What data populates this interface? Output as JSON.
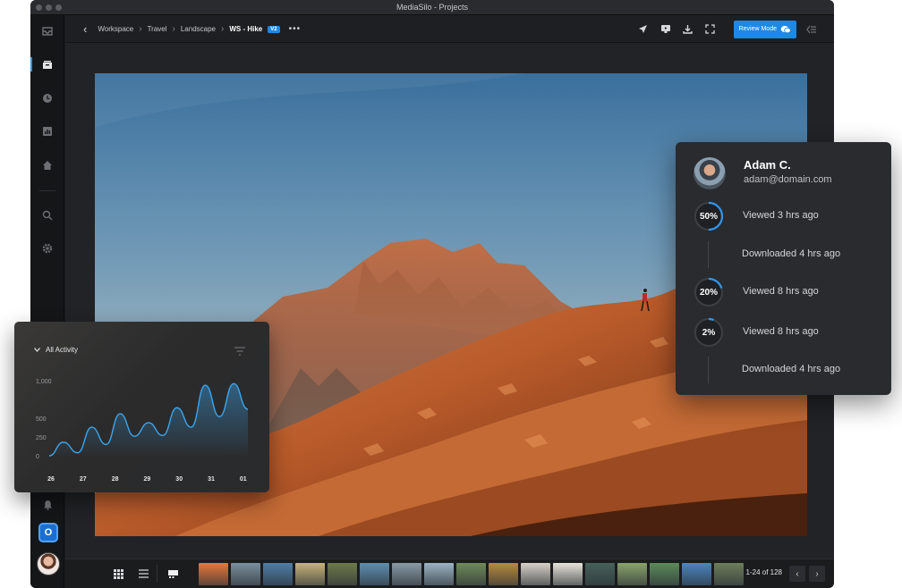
{
  "window": {
    "title": "MediaSilo - Projects"
  },
  "breadcrumb": {
    "items": [
      "Workspace",
      "Travel",
      "Landscape"
    ],
    "current": "WS - Hike",
    "version": "V2"
  },
  "toolbar": {
    "review_label": "Review Mode"
  },
  "filmstrip": {
    "pager": "1-24 of 128",
    "thumb_colors": [
      "#e8773c",
      "#7a8f9c",
      "#4f7ea8",
      "#c9b57a",
      "#6f7a4a",
      "#5e8fb0",
      "#8a9aa6",
      "#9cb4c4",
      "#6f8a5a",
      "#b98a3e",
      "#d8d2c8",
      "#e7e4da",
      "#47615a",
      "#89a36a",
      "#5b8a5a",
      "#4a86c2",
      "#6d7d5a"
    ]
  },
  "activity": {
    "title": "All Activity",
    "chart_data": {
      "type": "area",
      "categories": [
        "26",
        "27",
        "28",
        "29",
        "30",
        "31",
        "01"
      ],
      "y_ticks": [
        "1,000",
        "500",
        "250",
        "0"
      ],
      "series": [
        {
          "values": [
            0,
            180,
            40,
            380,
            150,
            560,
            260,
            440,
            270,
            640,
            380,
            940,
            520,
            960,
            620
          ]
        }
      ]
    }
  },
  "viewers": {
    "user": {
      "name": "Adam C.",
      "email": "adam@domain.com"
    },
    "events": [
      {
        "percent": "50%",
        "fraction": 0.5,
        "text": "Viewed 3 hrs ago"
      },
      {
        "percent": "",
        "fraction": null,
        "text": "Downloaded 4 hrs ago"
      },
      {
        "percent": "20%",
        "fraction": 0.2,
        "text": "Viewed 8 hrs ago"
      },
      {
        "percent": "2%",
        "fraction": 0.02,
        "text": "Viewed 8 hrs ago"
      },
      {
        "percent": "",
        "fraction": null,
        "text": "Downloaded 4 hrs ago"
      }
    ]
  }
}
